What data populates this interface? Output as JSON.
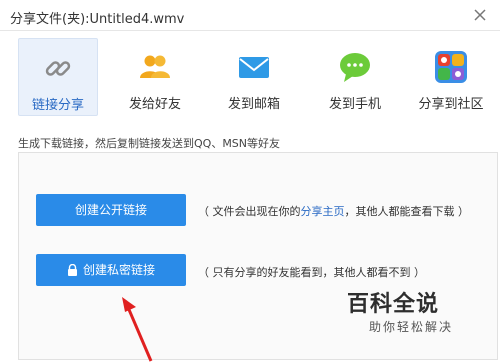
{
  "window": {
    "title": "分享文件(夹):Untitled4.wmv"
  },
  "share_options": [
    {
      "label": "链接分享",
      "icon": "link-icon",
      "active": true
    },
    {
      "label": "发给好友",
      "icon": "friends-icon",
      "active": false
    },
    {
      "label": "发到邮箱",
      "icon": "mail-icon",
      "active": false
    },
    {
      "label": "发到手机",
      "icon": "chat-bubble-icon",
      "active": false
    },
    {
      "label": "分享到社区",
      "icon": "community-apps-icon",
      "active": false
    }
  ],
  "description": "生成下载链接，然后复制链接发送到QQ、MSN等好友",
  "public_link": {
    "button_label": "创建公开链接",
    "note_prefix": "（ 文件会出现在你的",
    "note_link": "分享主页",
    "note_suffix": "，其他人都能查看下载 ）"
  },
  "private_link": {
    "button_label": "创建私密链接",
    "note": "（ 只有分享的好友能看到，其他人都看不到 ）"
  },
  "watermark": {
    "title": "百科全说",
    "subtitle": "助你轻松解决"
  },
  "colors": {
    "accent": "#2a8be8",
    "active_bg": "#eaf1fb",
    "link": "#2a6ac4",
    "arrow": "#e02020"
  }
}
